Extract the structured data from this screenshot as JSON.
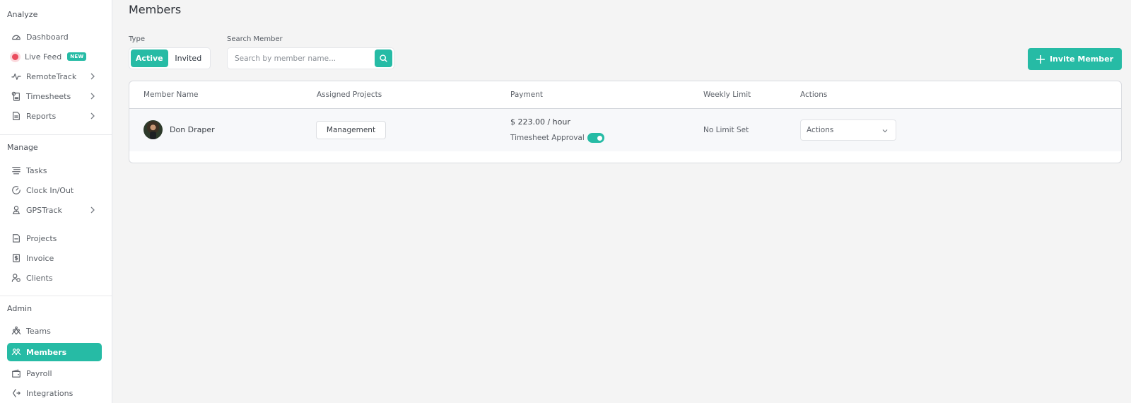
{
  "sidebar": {
    "sections": [
      {
        "title": "Analyze",
        "items": [
          {
            "label": "Dashboard",
            "icon": "gauge-icon"
          },
          {
            "label": "Live Feed",
            "icon": "live-dot-icon",
            "badge": "NEW"
          },
          {
            "label": "RemoteTrack",
            "icon": "pulse-icon",
            "has_submenu": true
          },
          {
            "label": "Timesheets",
            "icon": "timesheet-icon",
            "has_submenu": true
          },
          {
            "label": "Reports",
            "icon": "report-icon",
            "has_submenu": true
          }
        ]
      },
      {
        "title": "Manage",
        "items": [
          {
            "label": "Tasks",
            "icon": "tasks-icon"
          },
          {
            "label": "Clock In/Out",
            "icon": "clock-icon"
          },
          {
            "label": "GPSTrack",
            "icon": "map-pin-icon",
            "has_submenu": true
          },
          {
            "label": "Projects",
            "icon": "project-icon"
          },
          {
            "label": "Invoice",
            "icon": "invoice-icon"
          },
          {
            "label": "Clients",
            "icon": "clients-icon"
          }
        ]
      },
      {
        "title": "Admin",
        "items": [
          {
            "label": "Teams",
            "icon": "teams-icon"
          },
          {
            "label": "Members",
            "icon": "members-icon",
            "active": true
          },
          {
            "label": "Payroll",
            "icon": "wallet-icon"
          },
          {
            "label": "Integrations",
            "icon": "integrations-icon"
          }
        ]
      }
    ]
  },
  "header": {
    "title": "Members",
    "type_label": "Type",
    "type_options": [
      "Active",
      "Invited"
    ],
    "type_selected": "Active",
    "search_label": "Search Member",
    "search_placeholder": "Search by member name...",
    "search_value": "",
    "invite_button": "Invite Member"
  },
  "table": {
    "columns": [
      "Member Name",
      "Assigned Projects",
      "Payment",
      "Weekly Limit",
      "Actions"
    ],
    "rows": [
      {
        "name": "Don Draper",
        "project": "Management",
        "payment": "$ 223.00 / hour",
        "approval_label": "Timesheet Approval",
        "approval_enabled": true,
        "weekly_limit": "No Limit Set",
        "actions_label": "Actions"
      }
    ]
  },
  "colors": {
    "accent": "#26bba5",
    "live": "#ea4c5d"
  }
}
